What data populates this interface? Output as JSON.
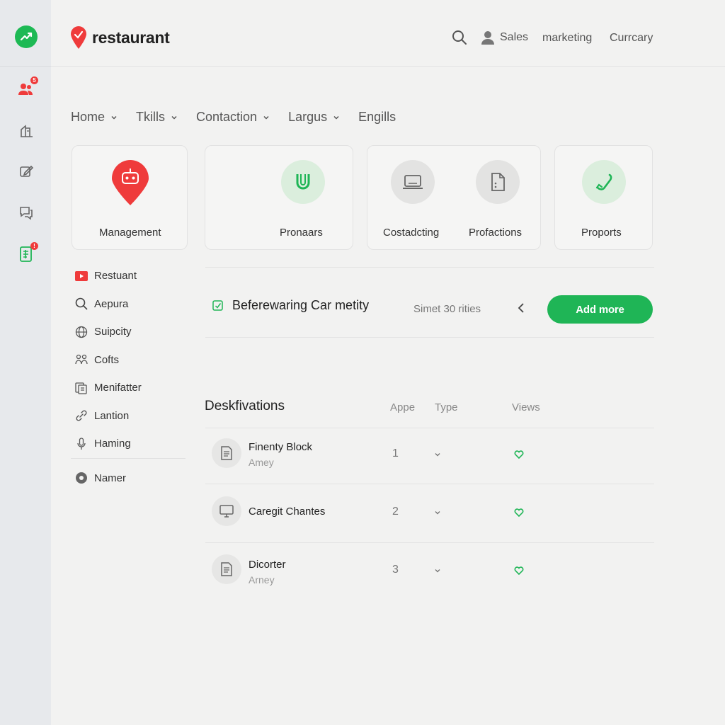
{
  "header": {
    "brand": "restaurant",
    "user_label": "Sales",
    "links": [
      "marketing",
      "Currcary"
    ]
  },
  "nav": [
    "Home",
    "Tkills",
    "Contaction",
    "Largus",
    "Engills"
  ],
  "cards": [
    {
      "label": "Management",
      "icon": "robot-pin-icon"
    },
    {
      "label": "Pronaars",
      "icon": "magnet-icon"
    },
    {
      "label": "Costadcting",
      "icon": "laptop-icon"
    },
    {
      "label": "Profactions",
      "icon": "document-icon"
    },
    {
      "label": "Proports",
      "icon": "phone-icon"
    }
  ],
  "side_list": {
    "items": [
      {
        "label": "Restuant",
        "icon": "video-icon"
      },
      {
        "label": "Aepura",
        "icon": "search-icon"
      },
      {
        "label": "Suipcity",
        "icon": "globe-icon"
      },
      {
        "label": "Cofts",
        "icon": "people-icon"
      },
      {
        "label": "Menifatter",
        "icon": "files-icon"
      },
      {
        "label": "Lantion",
        "icon": "link-icon"
      },
      {
        "label": "Haming",
        "icon": "microphone-icon"
      }
    ],
    "extra": {
      "label": "Namer",
      "icon": "settings-icon"
    }
  },
  "promo": {
    "title": "Beferewaring Car metity",
    "count_text": "Simet 30 rities",
    "button": "Add more"
  },
  "table": {
    "title": "Deskfivations",
    "columns": [
      "Appe",
      "Type",
      "Views"
    ],
    "rows": [
      {
        "name": "Finenty Block",
        "sub": "Amey",
        "num": "1",
        "icon": "document-icon"
      },
      {
        "name": "Caregit Chantes",
        "sub": "",
        "num": "2",
        "icon": "monitor-icon"
      },
      {
        "name": "Dicorter",
        "sub": "Arney",
        "num": "3",
        "icon": "document-icon"
      }
    ]
  },
  "rail": {
    "badges": [
      "5",
      "!"
    ]
  },
  "colors": {
    "accent_green": "#1fb556",
    "accent_red": "#ef3b3b",
    "background": "#f2f2f1"
  }
}
